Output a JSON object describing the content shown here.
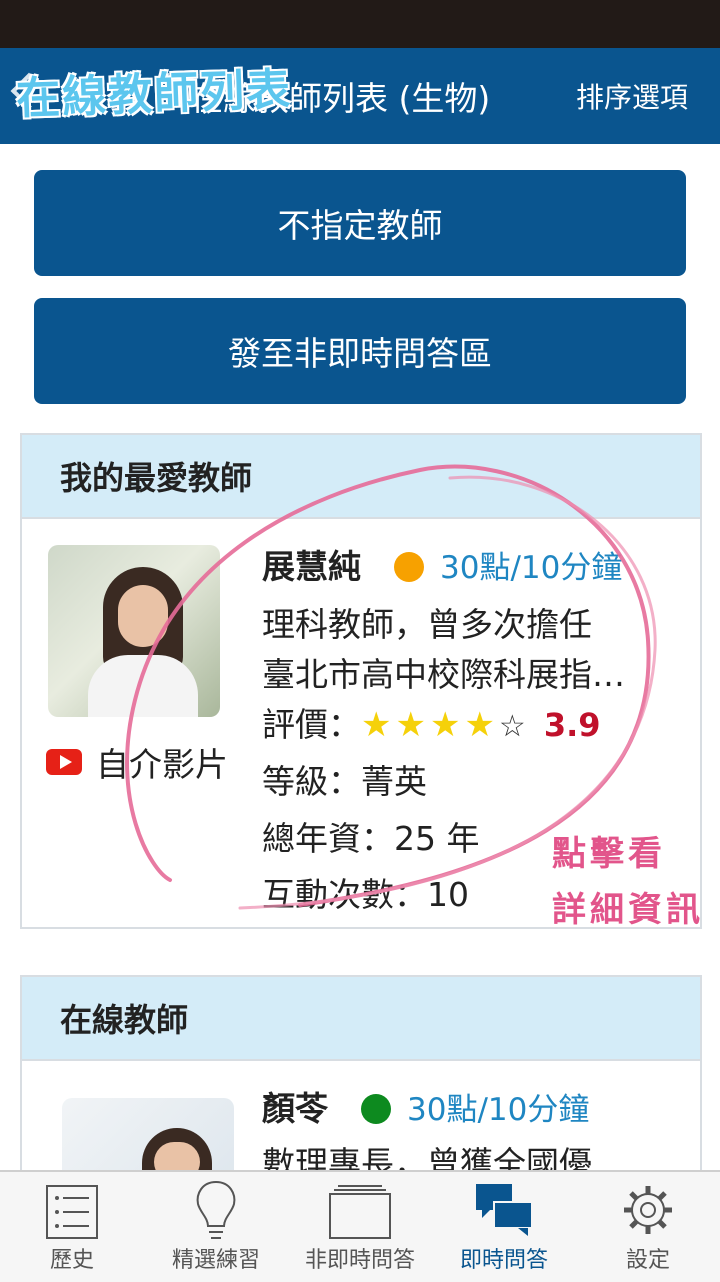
{
  "navbar": {
    "title": "在線教師列表 (生物)",
    "sort": "排序選項",
    "overlay_title": "在線教師列表"
  },
  "buttons": {
    "any_teacher": "不指定教師",
    "non_realtime": "發至非即時問答區"
  },
  "favorites": {
    "header": "我的最愛教師",
    "teacher": {
      "name": "展慧純",
      "status_color": "#f7a100",
      "price": "30點/10分鐘",
      "desc_line1": "理科教師，曾多次擔任",
      "desc_line2": "臺北市高中校際科展指…",
      "rating_label": "評價：",
      "stars_filled": "★★★★",
      "stars_empty": "☆",
      "rating_value": "3.9",
      "level": "等級：菁英",
      "years": "總年資：25 年",
      "interactions": "互動次數：10",
      "video_label": "自介影片"
    }
  },
  "online": {
    "header": "在線教師",
    "teacher": {
      "name": "顏苓",
      "status_color": "#0d8a1f",
      "price": "30點/10分鐘",
      "desc_line1": "數理專長，曾獲全國優"
    }
  },
  "annotation": {
    "line1": "點擊看",
    "line2": "詳細資訊"
  },
  "tabs": [
    {
      "label": "歷史",
      "icon": "history-icon"
    },
    {
      "label": "精選練習",
      "icon": "lightbulb-icon"
    },
    {
      "label": "非即時問答",
      "icon": "stack-icon"
    },
    {
      "label": "即時問答",
      "icon": "chat-bubbles-icon"
    },
    {
      "label": "設定",
      "icon": "gear-icon"
    }
  ],
  "colors": {
    "primary": "#0a558f",
    "header_bg": "#d4ecf8",
    "price": "#1f86c2",
    "rating": "#c0112b",
    "annotation": "#e2558b"
  }
}
